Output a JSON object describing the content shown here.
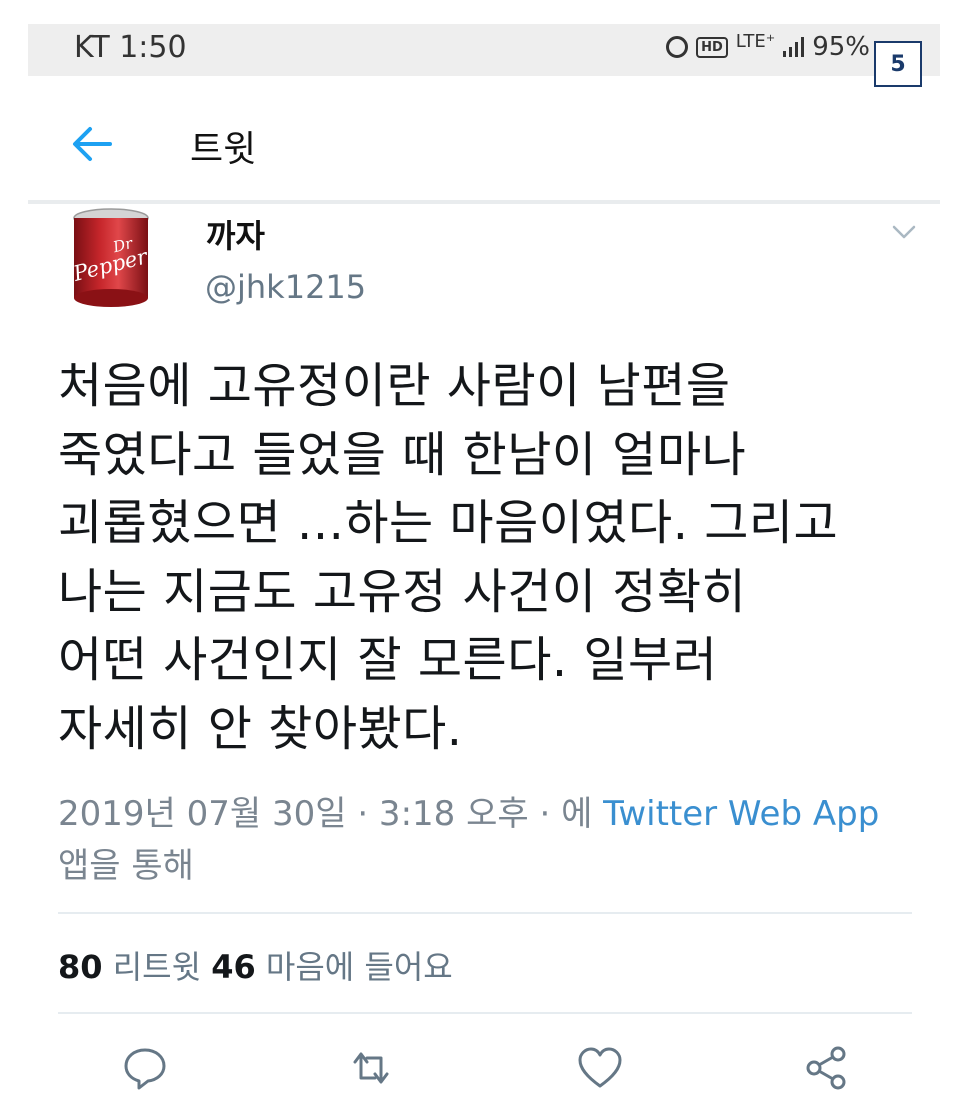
{
  "status_bar": {
    "carrier_time": "KT 1:50",
    "hd": "HD",
    "network": "LTE⁺",
    "battery": "95%"
  },
  "page_badge": "5",
  "header": {
    "title": "트윗"
  },
  "tweet": {
    "display_name": "까자",
    "handle": "@jhk1215",
    "text_lines": [
      "처음에 고유정이란 사람이 남편을",
      "죽였다고 들었을 때 한남이 얼마나",
      "괴롭혔으면 ...하는 마음이였다. 그리고",
      "나는 지금도 고유정 사건이 정확히",
      "어떤 사건인지 잘 모른다. 일부러",
      "자세히 안 찾아봤다."
    ],
    "timestamp": "2019년 07월 30일 · 3:18 오후 · 에 ",
    "source_app": "Twitter Web App",
    "source_suffix": "앱을 통해",
    "retweet_count": "80",
    "retweet_label": " 리트윗 ",
    "like_count": "46",
    "like_label": " 마음에 들어요"
  },
  "icons": {
    "back": "back-arrow-icon",
    "menu": "chevron-down-icon",
    "reply": "reply-icon",
    "retweet": "retweet-icon",
    "like": "heart-icon",
    "share": "share-icon"
  },
  "colors": {
    "accent": "#1da1f2",
    "link": "#3a8fd0",
    "muted": "#657786"
  }
}
